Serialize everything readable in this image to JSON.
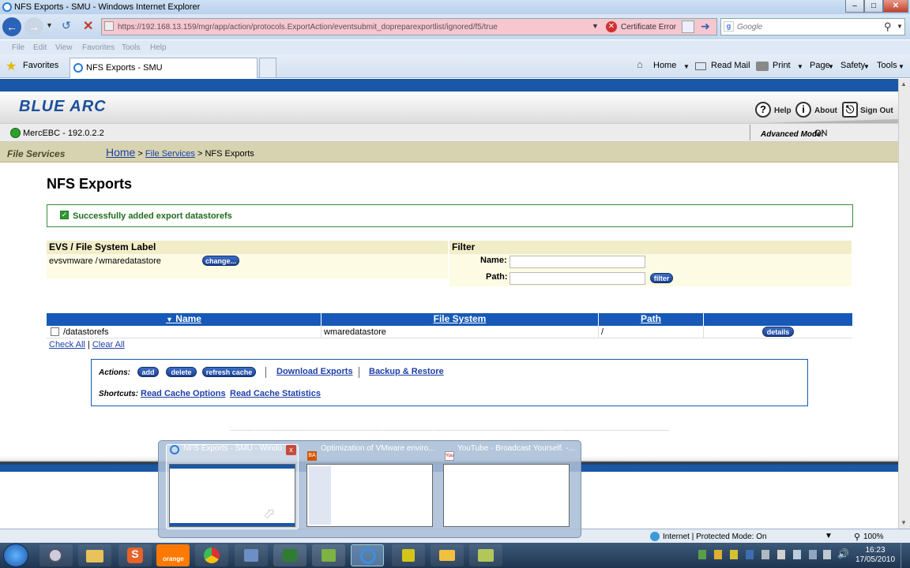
{
  "window": {
    "title": "NFS Exports - SMU - Windows Internet Explorer"
  },
  "browser": {
    "url": "https://192.168.13.159/mgr/app/action/protocols.ExportAction/eventsubmit_dopreparexportlist/ignored/f5/true",
    "cert_error": "Certificate Error",
    "search_placeholder": "Google",
    "menu": [
      "File",
      "Edit",
      "View",
      "Favorites",
      "Tools",
      "Help"
    ],
    "favorites_label": "Favorites",
    "tab_title": "NFS Exports - SMU",
    "commands": {
      "home": "Home",
      "read_mail": "Read Mail",
      "print": "Print",
      "page": "Page",
      "safety": "Safety",
      "tools": "Tools"
    }
  },
  "app": {
    "logo": "BLUE ARC",
    "help": "Help",
    "about": "About",
    "signout": "Sign Out",
    "server": "MercEBC - 192.0.2.2",
    "advanced_mode_label": "Advanced Mode:",
    "advanced_mode_value": "ON",
    "section": "File Services",
    "breadcrumb": {
      "home": "Home",
      "sep1": ">",
      "file_services": "File Services",
      "sep2": ">",
      "current": "NFS Exports"
    }
  },
  "page": {
    "title": "NFS Exports",
    "success": "Successfully added export datastorefs",
    "evs_header": "EVS / File System Label",
    "evs_value": "evsvmware /",
    "fs_value": "wmaredatastore",
    "change_button": "change...",
    "filter_header": "Filter",
    "name_label": "Name:",
    "path_label": "Path:",
    "filter_button": "filter"
  },
  "table": {
    "sort_indicator": "▼",
    "columns": [
      "Name",
      "File System",
      "Path"
    ],
    "rows": [
      {
        "name": "/datastorefs",
        "file_system": "wmaredatastore",
        "path": "/",
        "action": "details"
      }
    ],
    "check_all": "Check All",
    "separator": "|",
    "clear_all": "Clear All"
  },
  "actions": {
    "actions_label": "Actions:",
    "add": "add",
    "delete": "delete",
    "refresh": "refresh cache",
    "download": "Download Exports",
    "backup": "Backup & Restore",
    "shortcuts_label": "Shortcuts:",
    "read_cache_options": "Read Cache Options",
    "read_cache_statistics": "Read Cache Statistics"
  },
  "thumbnails": [
    {
      "title": "NFS Exports - SMU - Windo...",
      "close": "x"
    },
    {
      "title": "Optimization of VMware enviro..."
    },
    {
      "title": "YouTube - Broadcast Yourself. -..."
    }
  ],
  "statusbar": {
    "zone": "Internet | Protected Mode: On",
    "zoom": "100%"
  },
  "taskbar": {
    "time": "16:23",
    "date": "17/05/2010",
    "orange_label": "orange"
  },
  "colors": {
    "ie_blue": "#1a57a6",
    "table_header": "#1659b8",
    "crumb_bar": "#d7d3b0",
    "success_green": "#2c7a2c"
  }
}
